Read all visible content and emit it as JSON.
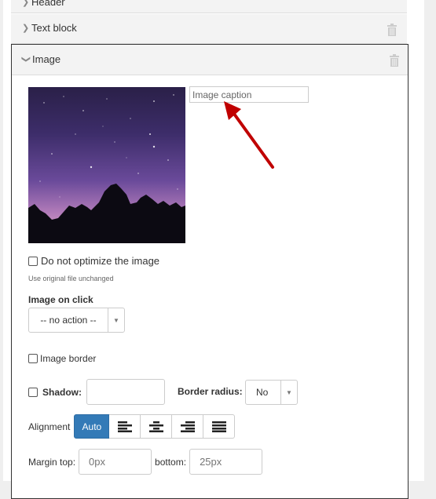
{
  "accordion": {
    "items": [
      {
        "label": "Header",
        "expanded": false
      },
      {
        "label": "Text block",
        "expanded": false
      },
      {
        "label": "Image",
        "expanded": true
      }
    ]
  },
  "image_block": {
    "thumbnail_alt": "Starry night sky over pine tree silhouettes",
    "caption": {
      "value": "",
      "placeholder": "Image caption"
    },
    "optimize": {
      "label": "Do not optimize the image",
      "checked": false,
      "hint": "Use original file unchanged"
    },
    "on_click": {
      "label": "Image on click",
      "selected": "-- no action --"
    },
    "image_border": {
      "label": "Image border",
      "checked": false
    },
    "shadow": {
      "label": "Shadow:",
      "checked": false,
      "value": ""
    },
    "border_radius": {
      "label": "Border radius:",
      "selected": "No"
    },
    "alignment": {
      "label": "Alignment",
      "options": [
        {
          "label": "Auto",
          "icon": "auto",
          "active": true
        },
        {
          "label": "",
          "icon": "align-left-icon",
          "active": false
        },
        {
          "label": "",
          "icon": "align-center-icon",
          "active": false
        },
        {
          "label": "",
          "icon": "align-right-icon",
          "active": false
        },
        {
          "label": "",
          "icon": "align-justify-icon",
          "active": false
        }
      ]
    },
    "margin": {
      "top_label": "Margin top:",
      "top_placeholder": "0px",
      "top_value": "",
      "bottom_label": "bottom:",
      "bottom_placeholder": "25px",
      "bottom_value": ""
    }
  },
  "annotation": {
    "type": "arrow",
    "color": "#c00000",
    "points_to": "caption"
  },
  "colors": {
    "accent": "#337ab7",
    "annotation": "#c00000",
    "panel_border": "#333333"
  }
}
